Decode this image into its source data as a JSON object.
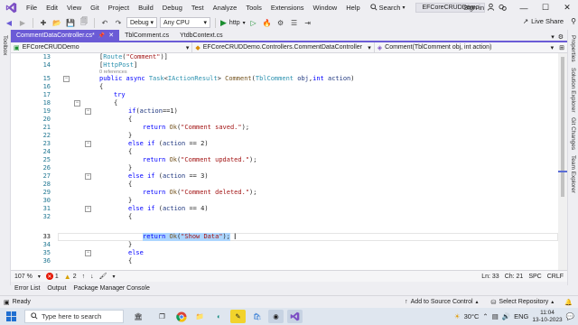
{
  "menu": {
    "items": [
      "File",
      "Edit",
      "View",
      "Git",
      "Project",
      "Build",
      "Debug",
      "Test",
      "Analyze",
      "Tools",
      "Extensions",
      "Window",
      "Help"
    ],
    "search_label": "Search",
    "solution_name": "EFCoreCRUDDemo",
    "signin": "Sign in"
  },
  "toolbar": {
    "config": "Debug",
    "platform": "Any CPU",
    "run_label": "http",
    "liveshare": "Live Share"
  },
  "left_strip": {
    "label": "Toolbox"
  },
  "right_strip": {
    "labels": [
      "Properties",
      "Solution Explorer",
      "Git Changes",
      "Team Explorer"
    ]
  },
  "tabs": [
    {
      "label": "CommentDataController.cs*",
      "active": true
    },
    {
      "label": "TblComment.cs",
      "active": false
    },
    {
      "label": "YtdbContext.cs",
      "active": false
    }
  ],
  "navbar": {
    "project": "EFCoreCRUDDemo",
    "class": "EFCoreCRUDDemo.Controllers.CommentDataController",
    "member": "Comment(TblComment obj, int action)"
  },
  "editor": {
    "references_label": "0 references",
    "lines": [
      {
        "n": "13",
        "text": "[Route(\"Comment\")]"
      },
      {
        "n": "14",
        "text": "[HttpPost]"
      },
      {
        "n": "15",
        "text": "public async Task<IActionResult> Comment(TblComment obj,int action)"
      },
      {
        "n": "16",
        "text": "{"
      },
      {
        "n": "17",
        "text": "try"
      },
      {
        "n": "18",
        "text": "{"
      },
      {
        "n": "19",
        "text": "if(action==1)"
      },
      {
        "n": "20",
        "text": "{"
      },
      {
        "n": "21",
        "text": "return Ok(\"Comment saved.\");"
      },
      {
        "n": "22",
        "text": "}"
      },
      {
        "n": "23",
        "text": "else if (action == 2)"
      },
      {
        "n": "24",
        "text": "{"
      },
      {
        "n": "25",
        "text": "return Ok(\"Comment updated.\");"
      },
      {
        "n": "26",
        "text": "}"
      },
      {
        "n": "27",
        "text": "else if (action == 3)"
      },
      {
        "n": "28",
        "text": "{"
      },
      {
        "n": "29",
        "text": "return Ok(\"Comment deleted.\");"
      },
      {
        "n": "30",
        "text": "}"
      },
      {
        "n": "31",
        "text": "else if (action == 4)"
      },
      {
        "n": "32",
        "text": "{"
      },
      {
        "n": "33",
        "text": "return Ok(\"Show Data\");"
      },
      {
        "n": "34",
        "text": "}"
      },
      {
        "n": "35",
        "text": "else"
      },
      {
        "n": "36",
        "text": "{"
      }
    ]
  },
  "editor_status": {
    "zoom": "107 %",
    "errors": "1",
    "warnings": "2",
    "position_ln": "Ln: 33",
    "position_ch": "Ch: 21",
    "spc": "SPC",
    "crlf": "CRLF"
  },
  "panel_tabs": [
    "Error List",
    "Output",
    "Package Manager Console"
  ],
  "statusbar": {
    "state": "Ready",
    "source_control": "Add to Source Control",
    "repository": "Select Repository"
  },
  "taskbar": {
    "search_placeholder": "Type here to search",
    "weather": "30°C",
    "lang": "ENG",
    "time": "11:04",
    "date": "13-10-2023"
  },
  "colors": {
    "accent": "#6b5bd6",
    "keyword": "#0000ff",
    "type": "#2b91af",
    "string": "#a31515",
    "selection": "#add6ff"
  }
}
